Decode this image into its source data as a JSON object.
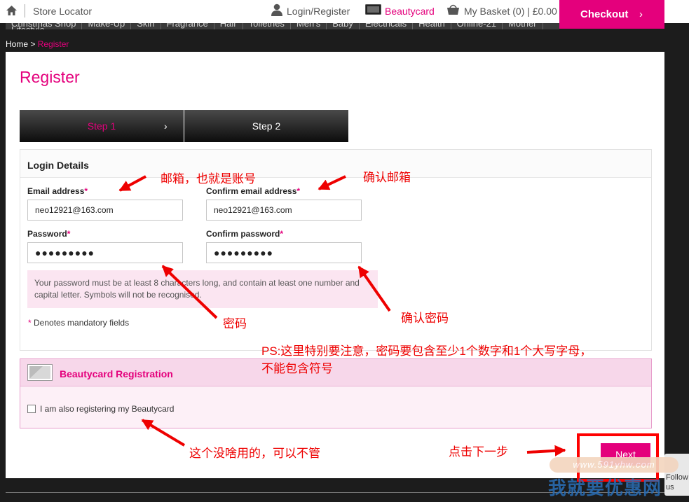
{
  "topbar": {
    "store_locator": "Store Locator",
    "login_register": "Login/Register",
    "beautycard": "Beautycard",
    "basket": "My Basket (0) | £0.00",
    "checkout": "Checkout",
    "checkout_chevron": "›"
  },
  "nav": {
    "items": [
      "Christmas Shop",
      "Make-Up",
      "Skin",
      "Fragrance",
      "Hair",
      "Toiletries",
      "Men's",
      "Baby",
      "Electricals",
      "Health",
      "Online-21",
      "Mother",
      "Lifestyle"
    ]
  },
  "breadcrumb": {
    "home": "Home",
    "separator": ">",
    "current": "Register"
  },
  "page": {
    "title": "Register"
  },
  "steps": [
    {
      "label": "Step 1",
      "active": true,
      "chevron": "›"
    },
    {
      "label": "Step 2",
      "active": false
    }
  ],
  "login_details": {
    "heading": "Login Details",
    "email_label": "Email address",
    "confirm_email_label": "Confirm email address",
    "password_label": "Password",
    "confirm_password_label": "Confirm password",
    "required_marker": "*",
    "email_value": "neo12921@163.com",
    "confirm_email_value": "neo12921@163.com",
    "password_value": "●●●●●●●●●",
    "confirm_password_value": "●●●●●●●●●",
    "password_hint": "Your password must be at least 8 characters long, and contain at least one number and capital letter. Symbols will not be recognised.",
    "mandatory_note": "Denotes mandatory fields"
  },
  "beautycard_registration": {
    "heading": "Beautycard Registration",
    "checkbox_label": "I am also registering my Beautycard",
    "checked": false
  },
  "actions": {
    "next": "Next"
  },
  "annotations": {
    "email_note": "邮箱，也就是账号",
    "confirm_email_note": "确认邮箱",
    "password_note": "密码",
    "confirm_password_note": "确认密码",
    "ps_line1": "PS:这里特别要注意，密码要包含至少1个数字和1个大写字母，",
    "ps_line2": "不能包含符号",
    "beautycard_note": "这个没啥用的，可以不管",
    "next_note": "点击下一步"
  },
  "watermark": {
    "url": "www.591yhw.com",
    "text": "我就要优惠网"
  },
  "follow_tab": {
    "line1": "Follow",
    "line2": "us"
  },
  "colors": {
    "brand_pink": "#e4007c",
    "annotation_red": "#ee0000",
    "page_background": "#1c1c1c"
  },
  "icons": [
    "home-icon",
    "user-icon",
    "beautycard-icon",
    "basket-icon",
    "chevron-right-icon",
    "card-icon",
    "checkbox-icon",
    "arrow-icon"
  ]
}
